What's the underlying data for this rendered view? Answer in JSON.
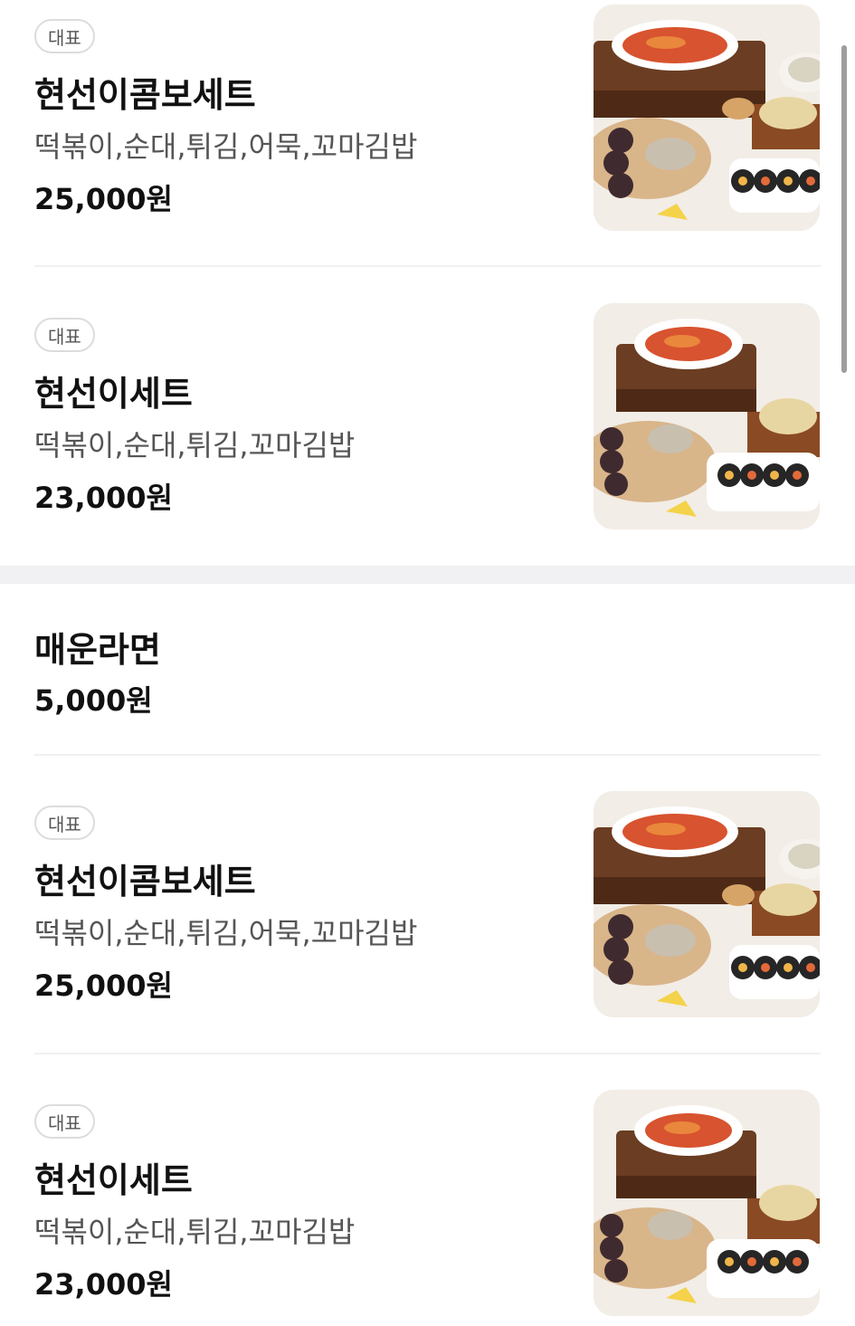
{
  "section_top": {
    "items": [
      {
        "badge": "대표",
        "name": "현선이콤보세트",
        "desc": "떡볶이,순대,튀김,어묵,꼬마김밥",
        "price": "25,000원",
        "image": "tteokbokki-combo-set-photo"
      },
      {
        "badge": "대표",
        "name": "현선이세트",
        "desc": "떡볶이,순대,튀김,꼬마김밥",
        "price": "23,000원",
        "image": "tteokbokki-set-photo"
      }
    ]
  },
  "section_bottom": {
    "items": [
      {
        "name": "매운라면",
        "price": "5,000원"
      },
      {
        "badge": "대표",
        "name": "현선이콤보세트",
        "desc": "떡볶이,순대,튀김,어묵,꼬마김밥",
        "price": "25,000원",
        "image": "tteokbokki-combo-set-photo"
      },
      {
        "badge": "대표",
        "name": "현선이세트",
        "desc": "떡볶이,순대,튀김,꼬마김밥",
        "price": "23,000원",
        "image": "tteokbokki-set-photo"
      }
    ]
  },
  "colors": {
    "background": "#ffffff",
    "divider": "#f1f1f1",
    "section_band": "#f1f1f3",
    "text_primary": "#111111",
    "text_secondary": "#555555",
    "badge_border": "#dcdcdc"
  }
}
